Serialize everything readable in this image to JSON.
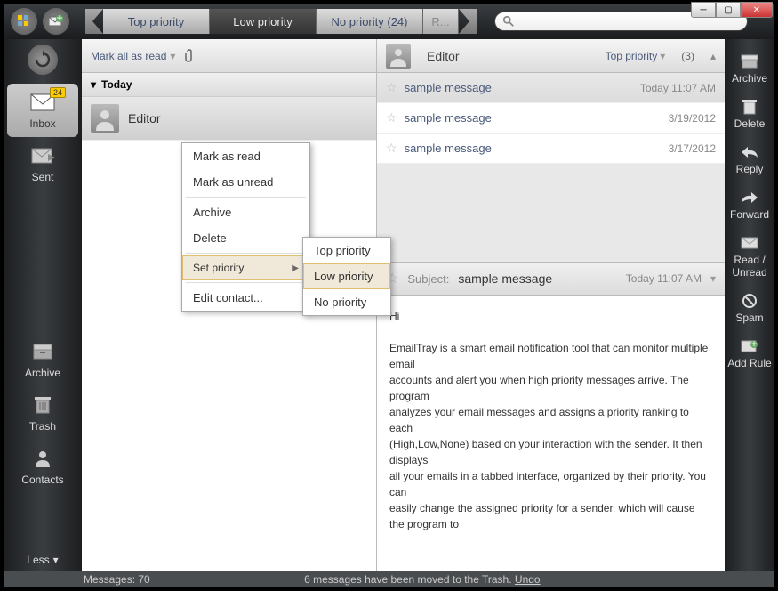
{
  "tabs": {
    "top": "Top priority",
    "low": "Low priority",
    "none": "No priority (24)",
    "overflow": "R..."
  },
  "leftNav": {
    "inbox": "Inbox",
    "inboxBadge": "24",
    "sent": "Sent",
    "archive": "Archive",
    "trash": "Trash",
    "contacts": "Contacts",
    "less": "Less"
  },
  "toolbar": {
    "markAll": "Mark all as read"
  },
  "list": {
    "group": "Today",
    "sender": "Editor"
  },
  "preview": {
    "sender": "Editor",
    "priority": "Top priority",
    "count": "(3)",
    "entries": [
      {
        "subject": "sample message",
        "date": "Today 11:07 AM"
      },
      {
        "subject": "sample message",
        "date": "3/19/2012"
      },
      {
        "subject": "sample message",
        "date": "3/17/2012"
      }
    ],
    "subjectLabel": "Subject:",
    "subject": "sample message",
    "subjectDate": "Today 11:07 AM",
    "body": "Hi\n\nEmailTray is a smart email notification tool that can monitor multiple email\naccounts and alert you when high priority messages arrive. The program\nanalyzes your email messages and assigns a priority ranking to each\n(High,Low,None) based on your interaction with the sender. It then displays\nall your emails in a tabbed interface, organized by their priority. You can\neasily change the assigned priority for a sender, which will cause the program to"
  },
  "rightActions": {
    "archive": "Archive",
    "delete": "Delete",
    "reply": "Reply",
    "forward": "Forward",
    "readUnread": "Read /\nUnread",
    "spam": "Spam",
    "addRule": "Add Rule"
  },
  "context": {
    "markRead": "Mark as read",
    "markUnread": "Mark as unread",
    "archive": "Archive",
    "delete": "Delete",
    "setPriority": "Set priority",
    "editContact": "Edit contact...",
    "subTop": "Top priority",
    "subLow": "Low priority",
    "subNone": "No priority"
  },
  "status": {
    "count": "Messages: 70",
    "undoMsg": "6 messages have been moved to the Trash.",
    "undo": "Undo"
  }
}
